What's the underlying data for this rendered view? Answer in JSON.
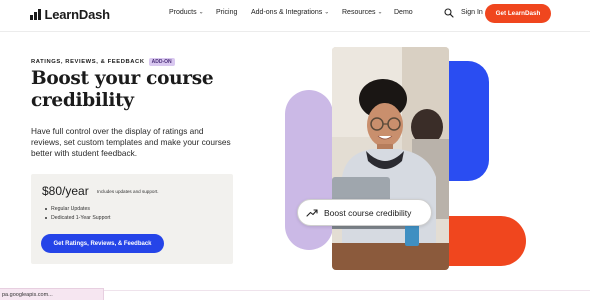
{
  "header": {
    "logo_text": "LearnDash",
    "nav": [
      {
        "label": "Products",
        "has_caret": true
      },
      {
        "label": "Pricing",
        "has_caret": false
      },
      {
        "label": "Add-ons & Integrations",
        "has_caret": true
      },
      {
        "label": "Resources",
        "has_caret": true
      },
      {
        "label": "Demo",
        "has_caret": false
      }
    ],
    "search_icon": "search-icon",
    "signin_label": "Sign In",
    "cta_label": "Get LearnDash"
  },
  "hero": {
    "eyebrow": "RATINGS, REVIEWS, & FEEDBACK",
    "badge": "ADD-ON",
    "headline_line1": "Boost your course",
    "headline_line2": "credibility",
    "description": "Have full control over the display of ratings and reviews, set custom templates and make your courses better with student feedback.",
    "pricing": {
      "price": "$80/year",
      "note": "Includes updates and support.",
      "features": [
        "Regular Updates",
        "Dedicated 1-Year Support"
      ],
      "cta_label": "Get Ratings, Reviews, & Feedback"
    },
    "stat_pill": {
      "icon": "trending-up-icon",
      "label": "Boost course credibility"
    }
  },
  "status_bar": {
    "text": "pa.googleapis.com..."
  },
  "colors": {
    "accent_orange": "#f0461e",
    "accent_blue": "#2544e8",
    "lavender": "#cbb9e6",
    "highlight_yellow": "#f3f37a",
    "pricing_bg": "#f2f1ee"
  }
}
